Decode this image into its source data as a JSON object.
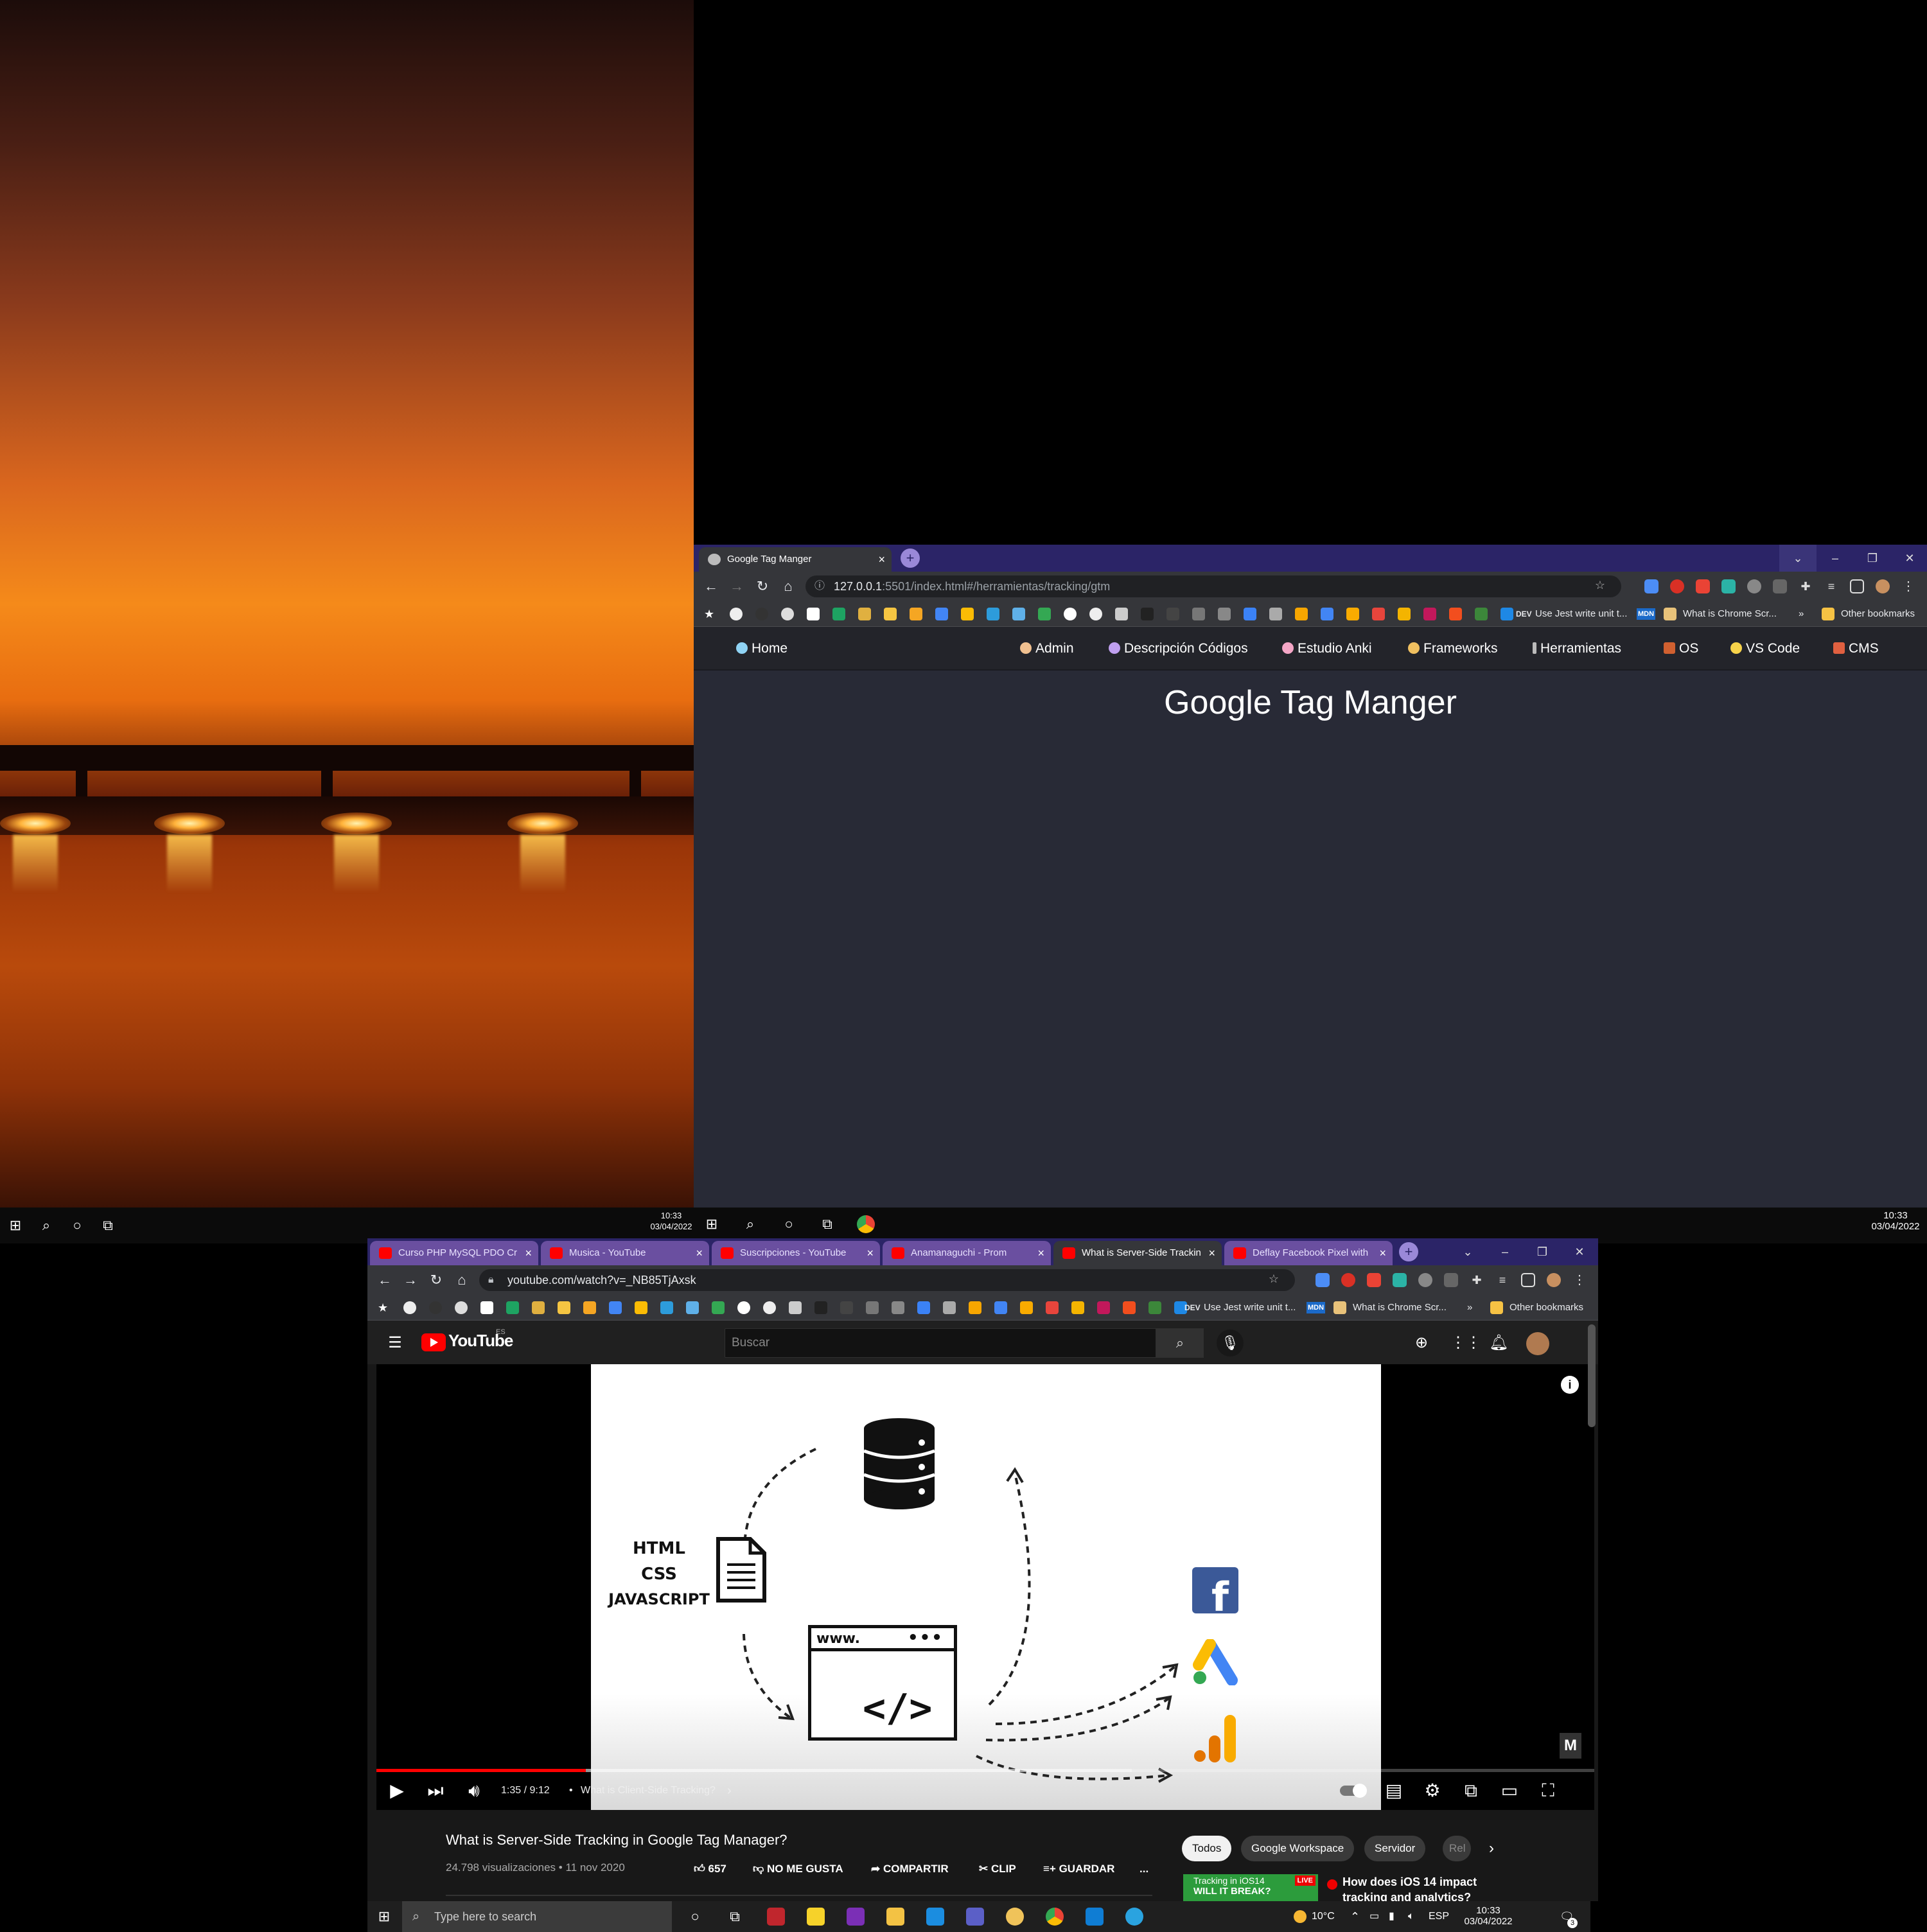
{
  "left_monitor_clock": {
    "time": "10:33",
    "date": "03/04/2022"
  },
  "right_monitor_clock": {
    "time": "10:33",
    "date": "03/04/2022"
  },
  "gtm_window": {
    "tab_title": "Google Tag Manger",
    "url_host": "127.0.0.1",
    "url_path": ":5501/index.html#/herramientas/tracking/gtm",
    "bookmarks": {
      "dev_label": "DEV",
      "item1": "Use Jest write unit t...",
      "mdn_label": "MDN",
      "item2": "What is Chrome Scr...",
      "more": "»",
      "other": "Other bookmarks"
    },
    "nav": {
      "home": "Home",
      "admin": "Admin",
      "descripcion": "Descripción Códigos",
      "anki": "Estudio Anki",
      "frameworks": "Frameworks",
      "herramientas": "Herramientas",
      "os": "OS",
      "vscode": "VS Code",
      "cms": "CMS"
    },
    "page_title": "Google Tag Manger"
  },
  "youtube_window": {
    "tabs": [
      "Curso PHP MySQL PDO Cr",
      "Musica - YouTube",
      "Suscripciones - YouTube",
      "Anamanaguchi - Prom",
      "What is Server-Side Trackin",
      "Deflay Facebook Pixel with"
    ],
    "url": "youtube.com/watch?v=_NB85TjAxsk",
    "bookmarks": {
      "dev_label": "DEV",
      "item1": "Use Jest write unit t...",
      "mdn_label": "MDN",
      "item2": "What is Chrome Scr...",
      "more": "»",
      "other": "Other bookmarks"
    },
    "logo_text": "YouTube",
    "logo_region": "ES",
    "search_placeholder": "Buscar",
    "video": {
      "html": "HTML",
      "css": "CSS",
      "js": "JAVASCRIPT",
      "www": "www.",
      "dots": "•••",
      "code": "</>",
      "watermark": "M"
    },
    "player": {
      "time": "1:35 / 9:12",
      "chapter": "What is Client-Side Tracking?",
      "chapter_arrow": "›",
      "progress_fraction": 0.172
    },
    "title": "What is Server-Side Tracking in Google Tag Manager?",
    "meta": "24.798 visualizaciones • 11 nov 2020",
    "actions": {
      "likes": "657",
      "dislike": "NO ME GUSTA",
      "share": "COMPARTIR",
      "clip": "CLIP",
      "save": "GUARDAR",
      "more": "..."
    },
    "chips": [
      "Todos",
      "Google Workspace",
      "Servidor",
      "Rel"
    ],
    "next_video_title": "How does iOS 14 impact",
    "next_video_title2": "tracking and analytics?",
    "thumb_text1": "Tracking in iOS14",
    "thumb_text2": "WILL IT BREAK?",
    "thumb_badge": "LIVE"
  },
  "taskbar": {
    "search_placeholder": "Type here to search",
    "temperature": "10°C",
    "lang": "ESP",
    "time": "10:33",
    "date": "03/04/2022",
    "notif_count": "3"
  },
  "colors": {
    "tabstrip": "#2b2467",
    "yt_red": "#ff0000",
    "page_bg": "#282a36"
  }
}
